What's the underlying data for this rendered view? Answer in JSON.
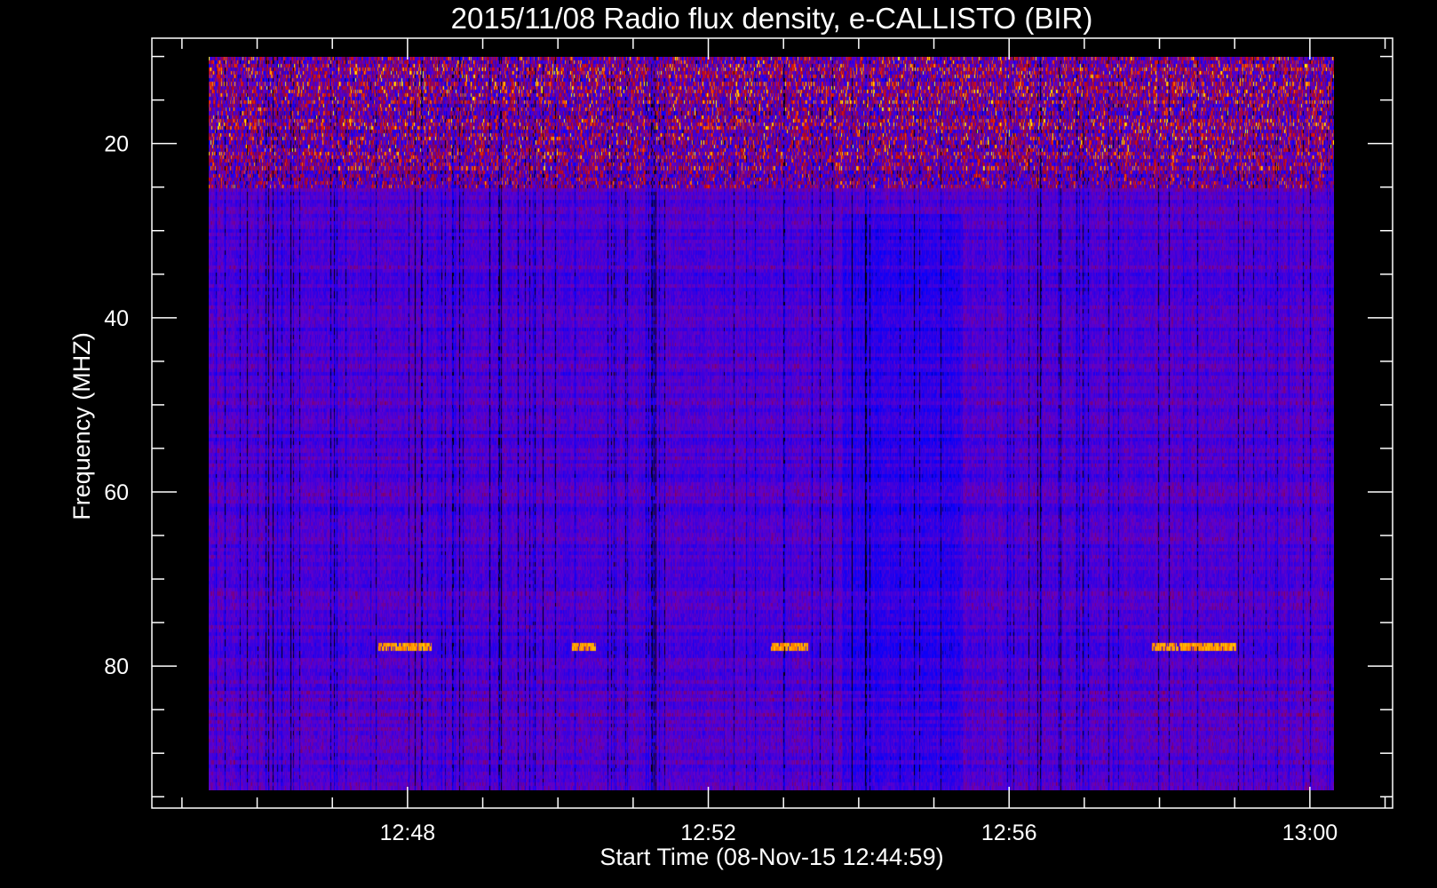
{
  "chart_data": {
    "type": "heatmap",
    "title": "2015/11/08  Radio flux density, e-CALLISTO (BIR)",
    "xlabel": "Start Time (08-Nov-15 12:44:59)",
    "ylabel": "Frequency (MHZ)",
    "x_unit": "minutes after 12:00 UT",
    "xlim": [
      44.6,
      61.1
    ],
    "ylim": [
      96.3,
      7.9
    ],
    "y_inverted": true,
    "data_extent": {
      "t": [
        45.36,
        60.36
      ],
      "f_mhz": [
        10.0,
        94.3
      ]
    },
    "x_major_ticks": [
      {
        "value": 48,
        "label": "12:48"
      },
      {
        "value": 52,
        "label": "12:52"
      },
      {
        "value": 56,
        "label": "12:56"
      },
      {
        "value": 60,
        "label": "13:00"
      }
    ],
    "x_minor_step": 1,
    "y_major_ticks": [
      {
        "value": 20,
        "label": "20"
      },
      {
        "value": 40,
        "label": "40"
      },
      {
        "value": 60,
        "label": "60"
      },
      {
        "value": 80,
        "label": "80"
      }
    ],
    "y_minor_step": 5,
    "colormap": [
      "#000000",
      "#0000ff",
      "#6400c8",
      "#8c003c",
      "#e61400",
      "#ff8c00",
      "#ffff00"
    ],
    "features": {
      "rfi_band_mhz": [
        10,
        25
      ],
      "narrowband_bursts_78mhz": [
        [
          47.62,
          48.33
        ],
        [
          50.2,
          50.52
        ],
        [
          52.85,
          53.35
        ],
        [
          57.93,
          59.05
        ]
      ],
      "dark_interval": [
        53.8,
        55.4
      ]
    }
  }
}
